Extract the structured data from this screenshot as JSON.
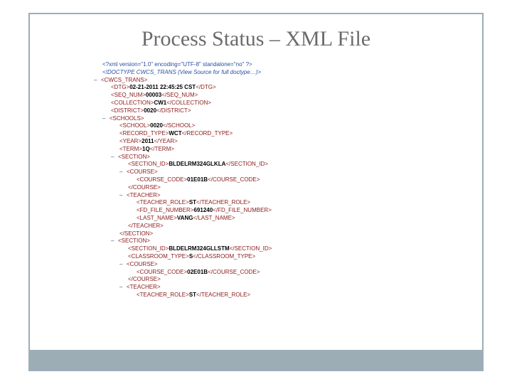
{
  "title": "Process Status – XML File",
  "xml": {
    "decl": "<?xml version=\"1.0\" encoding=\"UTF-8\" standalone=\"no\" ?>",
    "doctype": "<!DOCTYPE CWCS_TRANS (View Source for full doctype…)>",
    "root_open": "<CWCS_TRANS>",
    "dtg_open": "<DTG>",
    "dtg_val": "02-21-2011 22:45:25 CST",
    "dtg_close": "</DTG>",
    "seq_open": "<SEQ_NUM>",
    "seq_val": "00003",
    "seq_close": "</SEQ_NUM>",
    "coll_open": "<COLLECTION>",
    "coll_val": "CW1",
    "coll_close": "</COLLECTION>",
    "dist_open": "<DISTRICT>",
    "dist_val": "0020",
    "dist_close": "</DISTRICT>",
    "schools_open": "<SCHOOLS>",
    "school_open": "<SCHOOL>",
    "school_val": "0020",
    "school_close": "</SCHOOL>",
    "rectype_open": "<RECORD_TYPE>",
    "rectype_val": "WCT",
    "rectype_close": "</RECORD_TYPE>",
    "year_open": "<YEAR>",
    "year_val": "2011",
    "year_close": "</YEAR>",
    "term_open": "<TERM>",
    "term_val": "1Q",
    "term_close": "</TERM>",
    "section_open": "<SECTION>",
    "secid_open": "<SECTION_ID>",
    "secid1_val": "BLDELRM324GLKLA",
    "secid_close": "</SECTION_ID>",
    "course_open": "<COURSE>",
    "ccode_open": "<COURSE_CODE>",
    "ccode1_val": "01E01B",
    "ccode_close": "</COURSE_CODE>",
    "course_close": "</COURSE>",
    "teacher_open": "<TEACHER>",
    "trole_open": "<TEACHER_ROLE>",
    "trole_val": "ST",
    "trole_close": "</TEACHER_ROLE>",
    "ffnum_open": "<FD_FILE_NUMBER>",
    "ffnum_val": "691240",
    "ffnum_close": "</FD_FILE_NUMBER>",
    "lname_open": "<LAST_NAME>",
    "lname_val": "VANG",
    "lname_close": "</LAST_NAME>",
    "teacher_close": "</TEACHER>",
    "section_close": "</SECTION>",
    "secid2_val": "BLDELRM324GLLSTM",
    "class_open": "<CLASSROOM_TYPE>",
    "class_val": "S",
    "class_close": "</CLASSROOM_TYPE>",
    "ccode2_val": "02E01B",
    "minus": "–"
  }
}
